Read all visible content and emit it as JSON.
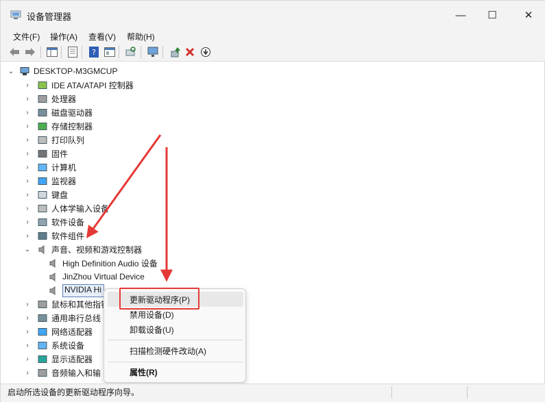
{
  "window": {
    "title": "设备管理器",
    "min_glyph": "—",
    "max_glyph": "☐",
    "close_glyph": "✕"
  },
  "menu": [
    "文件(F)",
    "操作(A)",
    "查看(V)",
    "帮助(H)"
  ],
  "toolbar_icons": [
    "back-icon",
    "forward-icon",
    "show-hide-tree-icon",
    "properties-icon",
    "help-icon",
    "view-icon",
    "scan-hardware-icon",
    "monitor-icon",
    "update-driver-icon",
    "uninstall-icon",
    "disable-icon"
  ],
  "tree": {
    "root": "DESKTOP-M3GMCUP",
    "categories": [
      {
        "label": "IDE ATA/ATAPI 控制器",
        "icon": "ide-controller-icon"
      },
      {
        "label": "处理器",
        "icon": "processor-icon"
      },
      {
        "label": "磁盘驱动器",
        "icon": "disk-drive-icon"
      },
      {
        "label": "存储控制器",
        "icon": "storage-controller-icon"
      },
      {
        "label": "打印队列",
        "icon": "printer-icon"
      },
      {
        "label": "固件",
        "icon": "firmware-icon"
      },
      {
        "label": "计算机",
        "icon": "computer-icon"
      },
      {
        "label": "监视器",
        "icon": "monitor-icon"
      },
      {
        "label": "键盘",
        "icon": "keyboard-icon"
      },
      {
        "label": "人体学输入设备",
        "icon": "hid-icon"
      },
      {
        "label": "软件设备",
        "icon": "software-device-icon"
      },
      {
        "label": "软件组件",
        "icon": "software-component-icon"
      },
      {
        "label": "声音、视频和游戏控制器",
        "icon": "speaker-icon"
      }
    ],
    "sound_children": [
      "High Definition Audio 设备",
      "JinZhou Virtual Device",
      "NVIDIA Hi"
    ],
    "after": [
      {
        "label": "鼠标和其他指针",
        "icon": "mouse-icon"
      },
      {
        "label": "通用串行总线",
        "icon": "usb-icon"
      },
      {
        "label": "网络适配器",
        "icon": "network-icon"
      },
      {
        "label": "系统设备",
        "icon": "system-device-icon"
      },
      {
        "label": "显示适配器",
        "icon": "display-adapter-icon"
      },
      {
        "label": "音频输入和输",
        "icon": "audio-io-icon"
      }
    ]
  },
  "context_menu": {
    "update": "更新驱动程序(P)",
    "disable": "禁用设备(D)",
    "uninstall": "卸载设备(U)",
    "scan": "扫描检测硬件改动(A)",
    "properties": "属性(R)"
  },
  "status": "启动所选设备的更新驱动程序向导。",
  "colors": {
    "annotation": "#e53935",
    "selection_border": "#5a7fb6",
    "selection_fill": "#e6eef9"
  }
}
